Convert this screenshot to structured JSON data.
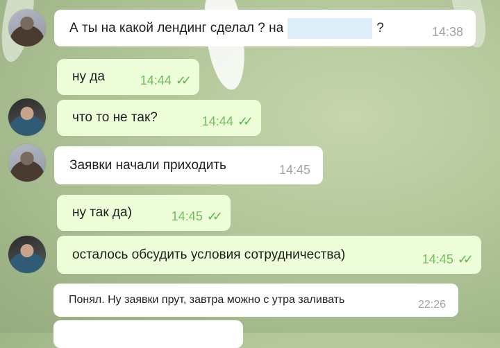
{
  "messages": [
    {
      "dir": "in",
      "text": "А ты на какой лендинг сделал ? на",
      "suffix": "?",
      "time": "14:38"
    },
    {
      "dir": "out",
      "text": "ну да",
      "time": "14:44"
    },
    {
      "dir": "out",
      "text": "что то не так?",
      "time": "14:44"
    },
    {
      "dir": "in",
      "text": "Заявки начали приходить",
      "time": "14:45"
    },
    {
      "dir": "out",
      "text": "ну так да)",
      "time": "14:45"
    },
    {
      "dir": "out",
      "text": "осталось обсудить условия сотрудничества)",
      "time": "14:45"
    },
    {
      "dir": "in",
      "text": "Понял. Ну заявки прут, завтра можно с утра заливать",
      "time": "22:26"
    }
  ],
  "colors": {
    "incoming_bubble": "#ffffff",
    "outgoing_bubble": "#eefed9",
    "read_check": "#58b84a",
    "background": "#b3c79a"
  },
  "icons": {
    "read_receipt": "double-check-icon"
  }
}
